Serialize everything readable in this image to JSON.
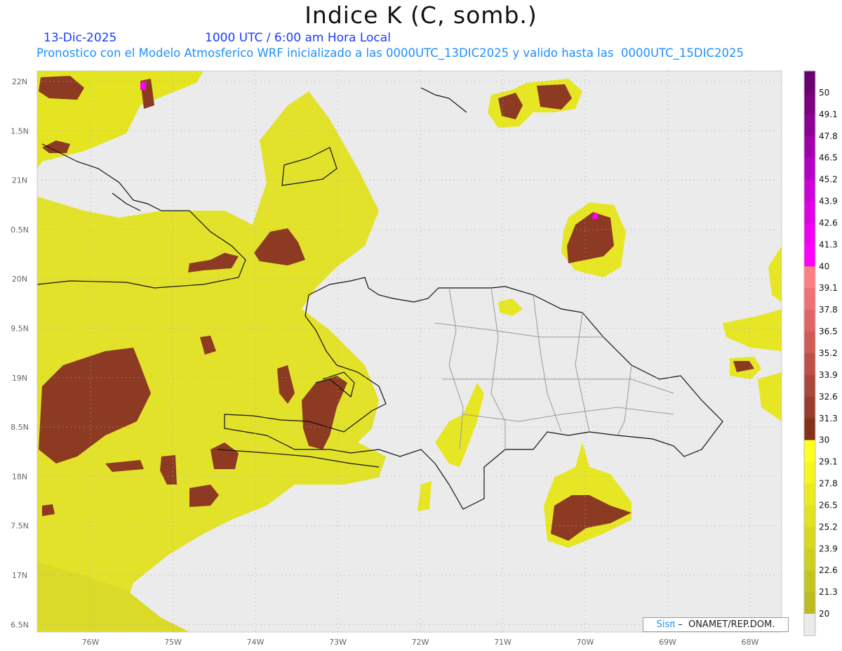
{
  "header": {
    "title": "Indice K (C, somb.)",
    "date": "13-Dic-2025",
    "time": "1000 UTC / 6:00 am Hora Local",
    "description": "Pronostico con el Modelo Atmosferico WRF inicializado a las 0000UTC_13DIC2025 y valido hasta las  0000UTC_15DIC2025"
  },
  "map": {
    "lon_labels": [
      "76W",
      "75W",
      "74W",
      "73W",
      "72W",
      "71W",
      "70W",
      "69W",
      "68W"
    ],
    "lon_values": [
      -76,
      -75,
      -74,
      -73,
      -72,
      -71,
      -70,
      -69,
      -68
    ],
    "lat_labels": [
      "22N",
      "1.5N",
      "21N",
      "0.5N",
      "20N",
      "9.5N",
      "19N",
      "8.5N",
      "18N",
      "7.5N",
      "17N",
      "6.5N"
    ],
    "lat_values": [
      22,
      21.5,
      21,
      20.5,
      20,
      19.5,
      19,
      18.5,
      18,
      17.5,
      17,
      16.5
    ],
    "background_color": "#ebebeb"
  },
  "colorbar": {
    "labels": [
      "50",
      "49.1",
      "47.8",
      "46.5",
      "45.2",
      "43.9",
      "42.6",
      "41.3",
      "40",
      "39.1",
      "37.8",
      "36.5",
      "35.2",
      "33.9",
      "32.6",
      "31.3",
      "30",
      "29.1",
      "27.8",
      "26.5",
      "25.2",
      "23.9",
      "22.6",
      "21.3",
      "20"
    ],
    "colors": [
      "#6a0070",
      "#7a0080",
      "#8c0096",
      "#a000ac",
      "#b600c4",
      "#cc00d8",
      "#e000e6",
      "#f000f2",
      "#ff00ff",
      "#ff8080",
      "#ef7272",
      "#e06666",
      "#cf5c55",
      "#bd5048",
      "#aa463c",
      "#993c2e",
      "#873018",
      "#ffff20",
      "#f5f520",
      "#ebeb20",
      "#e2e220",
      "#d8d820",
      "#cfcf20",
      "#c4c420",
      "#bcbc20",
      "#ebebeb"
    ]
  },
  "credit": {
    "brand": "Sisπ",
    "text": " –  ONAMET/REP.DOM."
  }
}
